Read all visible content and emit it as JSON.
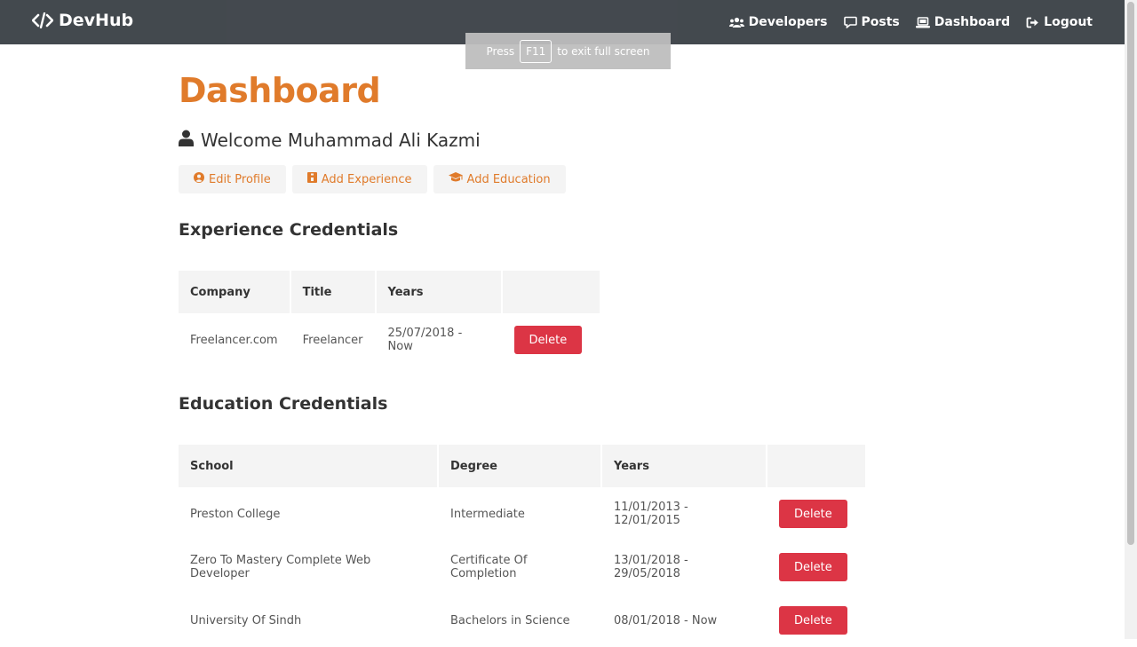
{
  "navbar": {
    "brand": "DevHub",
    "links": [
      {
        "label": "Developers",
        "icon": "users-icon"
      },
      {
        "label": "Posts",
        "icon": "comment-icon"
      },
      {
        "label": "Dashboard",
        "icon": "laptop-icon"
      },
      {
        "label": "Logout",
        "icon": "sign-out-icon"
      }
    ]
  },
  "fullscreen_toast": {
    "press": "Press",
    "key": "F11",
    "suffix": "to exit full screen"
  },
  "page": {
    "title": "Dashboard",
    "welcome": "Welcome Muhammad Ali Kazmi",
    "actions": [
      {
        "label": "Edit Profile",
        "icon": "user-circle-icon"
      },
      {
        "label": "Add Experience",
        "icon": "briefcase-icon"
      },
      {
        "label": "Add Education",
        "icon": "graduation-cap-icon"
      }
    ]
  },
  "experience": {
    "title": "Experience Credentials",
    "headers": [
      "Company",
      "Title",
      "Years",
      ""
    ],
    "rows": [
      {
        "company": "Freelancer.com",
        "title": "Freelancer",
        "years": "25/07/2018 - Now",
        "action": "Delete"
      }
    ]
  },
  "education": {
    "title": "Education Credentials",
    "headers": [
      "School",
      "Degree",
      "Years",
      ""
    ],
    "rows": [
      {
        "school": "Preston College",
        "degree": "Intermediate",
        "years": "11/01/2013 - 12/01/2015",
        "action": "Delete"
      },
      {
        "school": "Zero To Mastery Complete Web Developer",
        "degree": "Certificate Of Completion",
        "years": "13/01/2018 - 29/05/2018",
        "action": "Delete"
      },
      {
        "school": "University Of Sindh",
        "degree": "Bachelors in Science",
        "years": "08/01/2018 - Now",
        "action": "Delete"
      }
    ]
  },
  "colors": {
    "accent": "#e07b2b",
    "navbar": "#343a40",
    "danger": "#dc3545",
    "light": "#f4f4f4"
  }
}
